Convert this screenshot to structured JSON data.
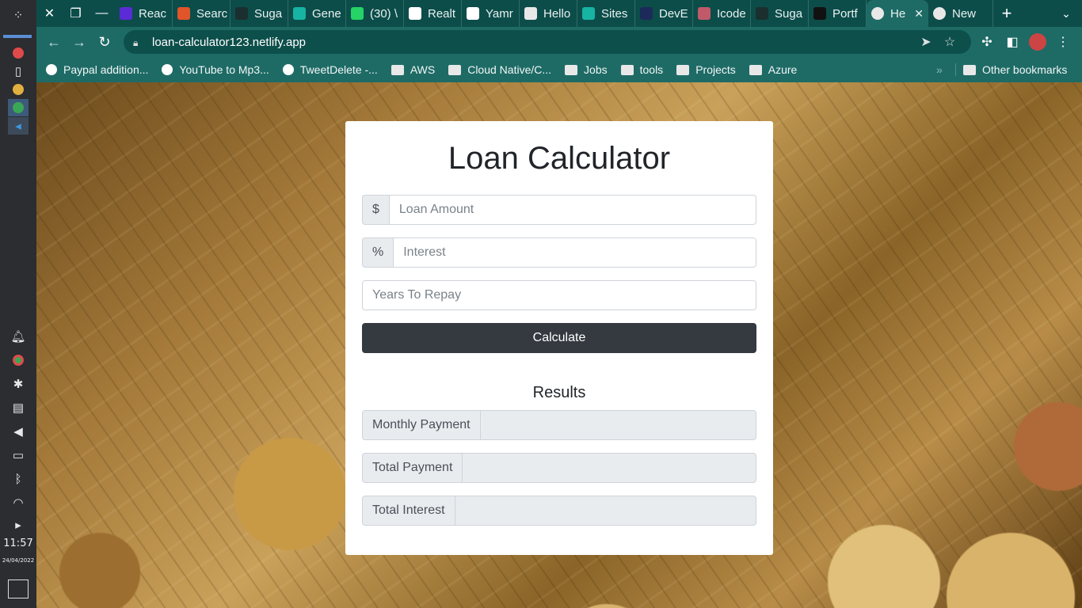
{
  "browser": {
    "tabs": [
      {
        "label": "Reac",
        "color": "#5b2bd6"
      },
      {
        "label": "Searc",
        "color": "#e0552a"
      },
      {
        "label": "Suga",
        "color": "#1b2f2e"
      },
      {
        "label": "Gene",
        "color": "#17b3a3"
      },
      {
        "label": "(30) \\",
        "color": "#25d366"
      },
      {
        "label": "Realt",
        "color": "#ffffff"
      },
      {
        "label": "Yamr",
        "color": "#ffffff"
      },
      {
        "label": "Hello",
        "color": "#e8e8e8"
      },
      {
        "label": "Sites",
        "color": "#17b3a3"
      },
      {
        "label": "DevE",
        "color": "#1c2a5a"
      },
      {
        "label": "Icode",
        "color": "#c05a6a"
      },
      {
        "label": "Suga",
        "color": "#1b2f2e"
      },
      {
        "label": "Portf",
        "color": "#111111"
      }
    ],
    "active_tab": {
      "label": "He",
      "color": "#e8e8e8"
    },
    "next_tab": {
      "label": "New",
      "color": "#e8e8e8"
    },
    "url": "loan-calculator123.netlify.app",
    "bookmarks": [
      {
        "label": "Paypal addition...",
        "type": "page"
      },
      {
        "label": "YouTube to Mp3...",
        "type": "page"
      },
      {
        "label": "TweetDelete -...",
        "type": "page"
      },
      {
        "label": "AWS",
        "type": "folder"
      },
      {
        "label": "Cloud Native/C...",
        "type": "folder"
      },
      {
        "label": "Jobs",
        "type": "folder"
      },
      {
        "label": "tools",
        "type": "folder"
      },
      {
        "label": "Projects",
        "type": "folder"
      },
      {
        "label": "Azure",
        "type": "folder"
      }
    ],
    "bookmarks_more": "»",
    "other_bookmarks": "Other bookmarks"
  },
  "os": {
    "time": "11:57",
    "date": "24/04/2022"
  },
  "calculator": {
    "title": "Loan Calculator",
    "amount_addon": "$",
    "amount_placeholder": "Loan Amount",
    "interest_addon": "%",
    "interest_placeholder": "Interest",
    "years_placeholder": "Years To Repay",
    "calculate_label": "Calculate",
    "results_title": "Results",
    "monthly_label": "Monthly Payment",
    "total_label": "Total Payment",
    "interest_label": "Total Interest"
  }
}
